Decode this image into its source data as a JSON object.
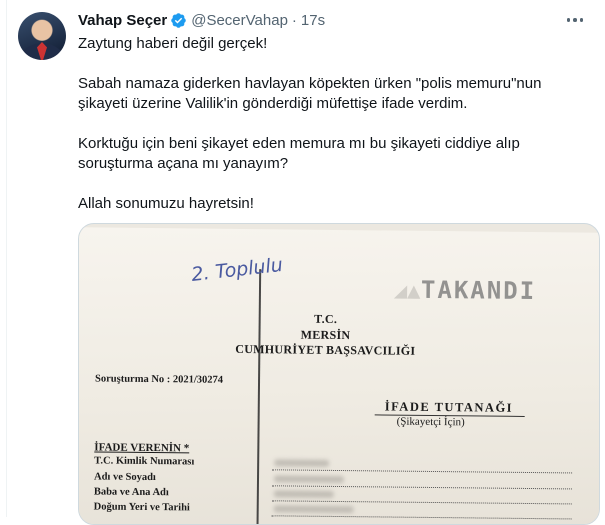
{
  "tweet": {
    "author_name": "Vahap Seçer",
    "handle": "@SecerVahap",
    "separator": "·",
    "time": "17s",
    "paragraphs": [
      "Zaytung haberi değil gerçek!",
      "Sabah namaza giderken havlayan köpekten ürken \"polis memuru\"nun şikayeti üzerine Valilik'in gönderdiği müfettişe ifade verdim.",
      "Korktuğu için beni şikayet eden memura mı bu şikayeti ciddiye alıp soruşturma açana mı yanayım?",
      "Allah sonumuzu hayretsin!"
    ]
  },
  "document": {
    "handwriting": "2. Toplulu",
    "stamp": "TAKANDI",
    "institution": [
      "T.C.",
      "MERSİN",
      "CUMHURİYET BAŞSAVCILIĞI"
    ],
    "case_number": "Soruşturma No : 2021/30274",
    "doc_title": "İFADE TUTANAĞI",
    "doc_subtitle": "(Şikayetçi İçin)",
    "section_title": "İFADE VERENİN *",
    "fields": [
      "T.C. Kimlik Numarası",
      "Adı ve Soyadı",
      "Baba ve Ana Adı",
      "Doğum Yeri ve Tarihi"
    ]
  },
  "colors": {
    "text_primary": "#0f1419",
    "text_secondary": "#536471",
    "verified_blue": "#1d9bf0",
    "border": "#cfd9de"
  },
  "icons": {
    "verified": "verified-badge-icon",
    "more": "more-options-icon"
  }
}
